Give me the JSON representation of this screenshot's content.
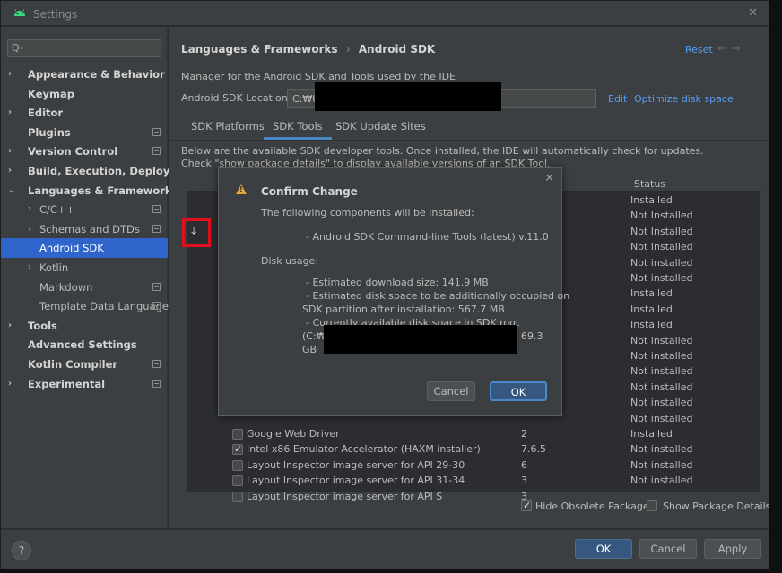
{
  "window": {
    "title": "Settings",
    "close_glyph": "✕"
  },
  "sidebar": {
    "search_placeholder": "Q-",
    "items": [
      {
        "label": "Appearance & Behavior",
        "chev": "›",
        "indent": 0,
        "bold": true
      },
      {
        "label": "Keymap",
        "chev": "",
        "indent": 0,
        "bold": true
      },
      {
        "label": "Editor",
        "chev": "›",
        "indent": 0,
        "bold": true
      },
      {
        "label": "Plugins",
        "chev": "",
        "indent": 0,
        "bold": true,
        "proj": true
      },
      {
        "label": "Version Control",
        "chev": "›",
        "indent": 0,
        "bold": true,
        "proj": true
      },
      {
        "label": "Build, Execution, Deployment",
        "chev": "›",
        "indent": 0,
        "bold": true
      },
      {
        "label": "Languages & Frameworks",
        "chev": "⌄",
        "indent": 0,
        "bold": true
      },
      {
        "label": "C/C++",
        "chev": "›",
        "indent": 1,
        "bold": false,
        "proj": true
      },
      {
        "label": "Schemas and DTDs",
        "chev": "›",
        "indent": 1,
        "bold": false,
        "proj": true
      },
      {
        "label": "Android SDK",
        "chev": "",
        "indent": 1,
        "bold": false,
        "selected": true
      },
      {
        "label": "Kotlin",
        "chev": "›",
        "indent": 1,
        "bold": false
      },
      {
        "label": "Markdown",
        "chev": "",
        "indent": 1,
        "bold": false,
        "proj": true
      },
      {
        "label": "Template Data Languages",
        "chev": "",
        "indent": 1,
        "bold": false,
        "proj": true
      },
      {
        "label": "Tools",
        "chev": "›",
        "indent": 0,
        "bold": true
      },
      {
        "label": "Advanced Settings",
        "chev": "",
        "indent": 0,
        "bold": true
      },
      {
        "label": "Kotlin Compiler",
        "chev": "",
        "indent": 0,
        "bold": true,
        "proj": true
      },
      {
        "label": "Experimental",
        "chev": "›",
        "indent": 0,
        "bold": true,
        "proj": true
      }
    ]
  },
  "header": {
    "breadcrumb_parent": "Languages & Frameworks",
    "breadcrumb_sep": "›",
    "breadcrumb_current": "Android SDK",
    "reset": "Reset",
    "arrows": "← →"
  },
  "main": {
    "description": "Manager for the Android SDK and Tools used by the IDE",
    "location_label": "Android SDK Location:",
    "location_value": "C:₩U",
    "edit": "Edit",
    "optimize": "Optimize disk space",
    "tabs": [
      "SDK Platforms",
      "SDK Tools",
      "SDK Update Sites"
    ],
    "info_line1": "Below are the available SDK developer tools. Once installed, the IDE will automatically check for updates.",
    "info_line2": "Check \"show package details\" to display available versions of an SDK Tool.",
    "status_header": "Status",
    "statuses": [
      "Installed",
      "Not Installed",
      "Not Installed",
      "Not Installed",
      "Not installed",
      "Not installed",
      "Installed",
      "Installed",
      "Installed",
      "Not installed",
      "Not installed",
      "Not installed",
      "Not installed",
      "Not installed",
      "Not installed",
      "Installed",
      "Not installed",
      "Not installed",
      "Not installed"
    ],
    "rows": [
      {
        "name": "Google Web Driver",
        "version": "2",
        "checked": false
      },
      {
        "name": "Intel x86 Emulator Accelerator (HAXM installer)",
        "version": "7.6.5",
        "checked": true
      },
      {
        "name": "Layout Inspector image server for API 29-30",
        "version": "6",
        "checked": false
      },
      {
        "name": "Layout Inspector image server for API 31-34",
        "version": "3",
        "checked": false
      },
      {
        "name": "Layout Inspector image server for API S",
        "version": "3",
        "checked": false
      }
    ],
    "hide_obsolete": "Hide Obsolete Packages",
    "show_details": "Show Package Details",
    "download_glyph": "⤓"
  },
  "dialog": {
    "title": "Confirm Change",
    "intro": "The following components will be installed:",
    "component": "- Android SDK Command-line Tools (latest) v.11.0",
    "disk_usage": "Disk usage:",
    "est_download": "- Estimated download size: 141.9 MB",
    "est_disk_1": "- Estimated disk space to be additionally occupied on",
    "est_disk_2": "SDK partition after installation: 567.7 MB",
    "avail_1": "- Currently available disk space in SDK root",
    "avail_2": "(C:₩",
    "avail_3": "69.3",
    "avail_4": "GB",
    "cancel": "Cancel",
    "ok": "OK",
    "close_glyph": "✕",
    "warn_glyph": "!"
  },
  "footer": {
    "help": "?",
    "ok": "OK",
    "cancel": "Cancel",
    "apply": "Apply"
  },
  "colors": {
    "accent": "#2f65ca",
    "link": "#589df6",
    "highlight": "#e0111e",
    "warning": "#e8a33d"
  }
}
